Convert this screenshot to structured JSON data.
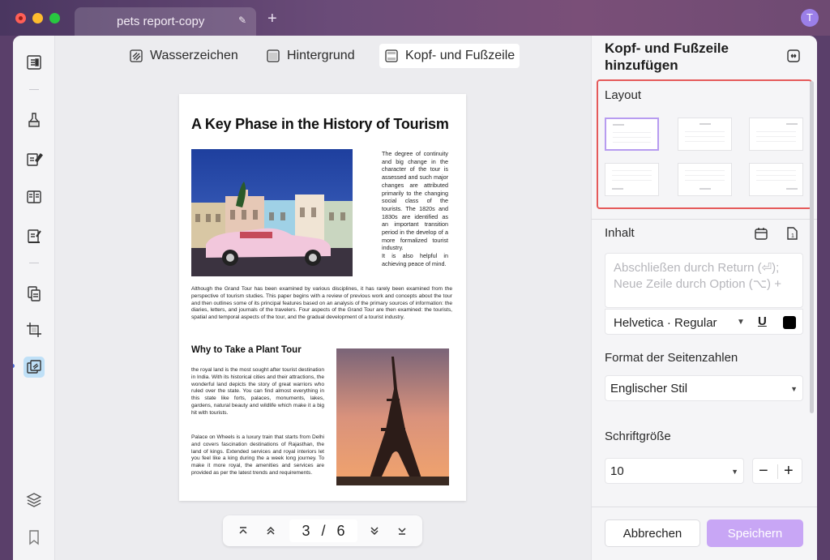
{
  "tab": {
    "title": "pets report-copy",
    "add_label": "+"
  },
  "user": {
    "avatar_initial": "T"
  },
  "toolbar": {
    "watermark": "Wasserzeichen",
    "background": "Hintergrund",
    "header_footer": "Kopf- und Fußzeile"
  },
  "document": {
    "title": "A Key Phase in the History of Tourism",
    "right_paragraph": "The degree of continuity and big change in the character of the tour is assessed and such major changes are attributed primarily to the changing social class of the tourists. The 1820s and 1830s are identified as an important transition period in the develop of a more formalized tourist industry.",
    "right_paragraph_2": "It is also helpful in achieving peace of mind.",
    "body_paragraph": "Although the Grand Tour has been examined by various disciplines, it has rarely been examined from the perspective of tourism studies. This paper begins with a review of previous work and concepts about the tour and then outlines some of its principal features based on an analysis of the primary sources of information: the diaries, letters, and journals of the travelers. Four aspects of the Grand Tour are then examined: the tourists, spatial and temporal aspects of the tour, and the gradual development of a tourist industry.",
    "subheading": "Why to Take a Plant Tour",
    "left_paragraph_1": "the royal land is the most sought after tourist destination in India. With its historical cities and their attractions, the wonderful land depicts the story of great warriors who ruled over the state. You can find almost everything in this state like forts, palaces, monuments, lakes, gardens, natural beauty and wildlife which make it a big hit with tourists.",
    "left_paragraph_2": "Palace on Wheels is a luxury train that starts from Delhi and covers fascination destinations of Rajasthan, the land of kings. Extended services and royal interiors let you feel like a king during the a week long journey. To make it more royal, the amenities and services are provided as per the latest trends and requirements."
  },
  "pager": {
    "current": "3",
    "separator": "/",
    "total": "6"
  },
  "panel": {
    "title": "Kopf- und Fußzeile hinzufügen",
    "layout_label": "Layout",
    "content_label": "Inhalt",
    "content_placeholder": "Abschließen durch Return (⏎); Neue Zeile durch Option (⌥) +",
    "font": "Helvetica · Regular",
    "underline_label": "U",
    "text_color": "#000000",
    "page_number_format_label": "Format der Seitenzahlen",
    "page_number_format": "Englischer Stil",
    "font_size_label": "Schriftgröße",
    "font_size": "10",
    "decrement": "−",
    "increment": "+",
    "cancel": "Abbrechen",
    "save": "Speichern"
  },
  "colors": {
    "accent_highlight": "#e55a5a",
    "save_button": "#c8a6f5",
    "selected_layout": "#b79cf0",
    "active_tool": "#bfe0f7"
  }
}
